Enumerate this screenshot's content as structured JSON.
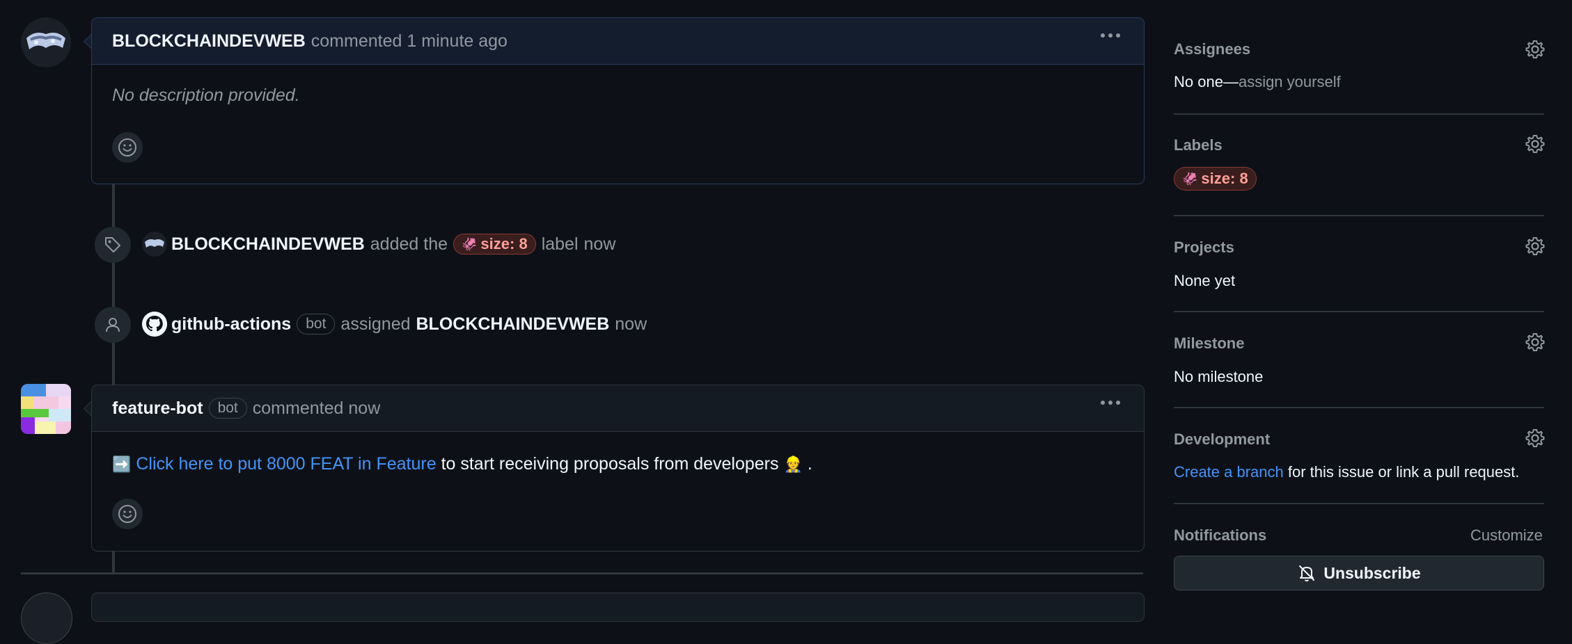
{
  "comments": [
    {
      "author": "BLOCKCHAINDEVWEB",
      "action": "commented",
      "time": "1 minute ago",
      "body": "No description provided."
    },
    {
      "author": "feature-bot",
      "badge": "bot",
      "action": "commented",
      "time": "now",
      "body_prefix_emoji": "➡️",
      "body_link": "Click here to put 8000 FEAT in Feature",
      "body_suffix": "to start receiving proposals from developers",
      "body_emoji": "👷",
      "body_end": "."
    }
  ],
  "events": [
    {
      "actor": "BLOCKCHAINDEVWEB",
      "pre": "added the",
      "label_emoji": "🦑",
      "label": "size: 8",
      "post": "label",
      "time": "now"
    },
    {
      "actor": "github-actions",
      "badge": "bot",
      "verb": "assigned",
      "target": "BLOCKCHAINDEVWEB",
      "time": "now"
    }
  ],
  "sidebar": {
    "assignees": {
      "title": "Assignees",
      "value_prefix": "No one—",
      "value_link": "assign yourself"
    },
    "labels": {
      "title": "Labels",
      "label_emoji": "🦑",
      "label": "size: 8"
    },
    "projects": {
      "title": "Projects",
      "value": "None yet"
    },
    "milestone": {
      "title": "Milestone",
      "value": "No milestone"
    },
    "development": {
      "title": "Development",
      "link": "Create a branch",
      "rest": "for this issue or link a pull request."
    },
    "notifications": {
      "title": "Notifications",
      "customize": "Customize",
      "button": "Unsubscribe"
    }
  },
  "colors": {
    "bg": "#0d1117",
    "link": "#4493f8",
    "label_bg": "#3a1d1d",
    "label_text": "#ffa198"
  }
}
